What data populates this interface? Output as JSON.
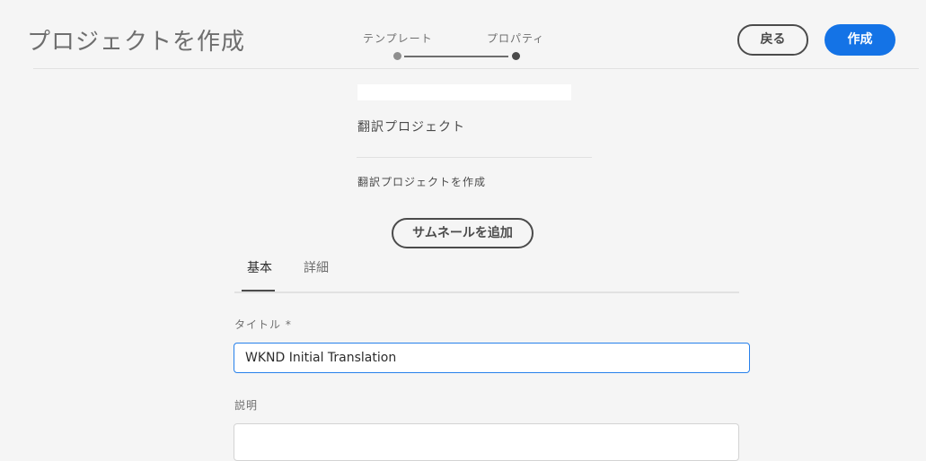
{
  "header": {
    "title": "プロジェクトを作成",
    "back_label": "戻る",
    "create_label": "作成"
  },
  "steps": [
    {
      "label": "テンプレート",
      "state": "done"
    },
    {
      "label": "プロパティ",
      "state": "current"
    }
  ],
  "template": {
    "name": "翻訳プロジェクト",
    "description": "翻訳プロジェクトを作成"
  },
  "thumbnail_button": "サムネールを追加",
  "tabs": [
    {
      "label": "基本",
      "active": true
    },
    {
      "label": "詳細",
      "active": false
    }
  ],
  "fields": {
    "title": {
      "label": "タイトル *",
      "value": "WKND Initial Translation"
    },
    "description": {
      "label": "説明",
      "value": ""
    }
  },
  "colors": {
    "accent": "#1473e6",
    "focus_border": "#2680eb",
    "background": "#f5f5f5"
  }
}
